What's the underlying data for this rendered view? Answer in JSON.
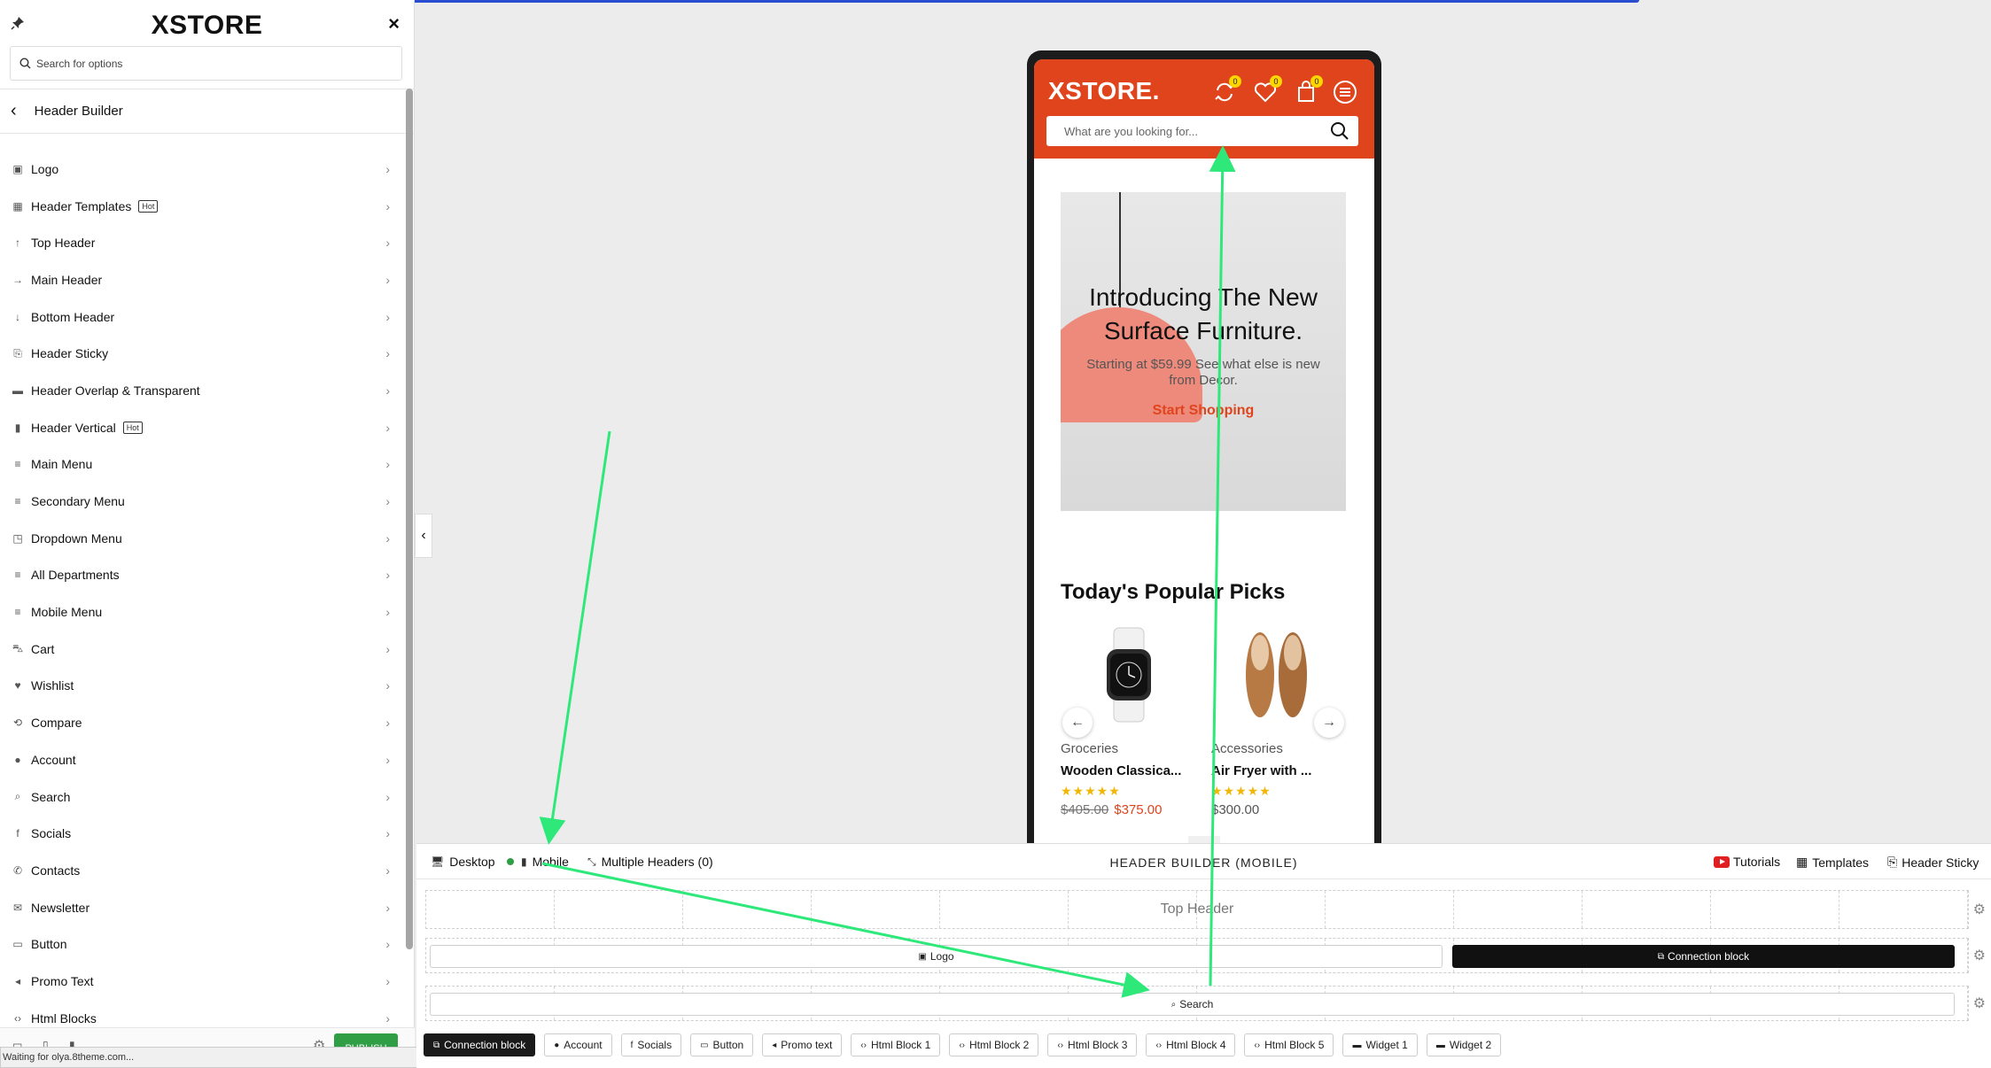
{
  "sidebar": {
    "brand": "XSTORE",
    "close": "×",
    "search_placeholder": "Search for options",
    "back_title": "Header Builder",
    "items": [
      {
        "label": "Logo",
        "hot": "",
        "icon": "image-icon"
      },
      {
        "label": "Header Templates",
        "hot": "Hot",
        "icon": "grid-icon"
      },
      {
        "label": "Top Header",
        "hot": "",
        "icon": "arrow-up-icon"
      },
      {
        "label": "Main Header",
        "hot": "",
        "icon": "arrow-right-icon"
      },
      {
        "label": "Bottom Header",
        "hot": "",
        "icon": "arrow-down-icon"
      },
      {
        "label": "Header Sticky",
        "hot": "",
        "icon": "paperclip-icon"
      },
      {
        "label": "Header Overlap & Transparent",
        "hot": "",
        "icon": "overlap-icon"
      },
      {
        "label": "Header Vertical",
        "hot": "Hot",
        "icon": "vertical-icon"
      },
      {
        "label": "Main Menu",
        "hot": "",
        "icon": "menu-icon"
      },
      {
        "label": "Secondary Menu",
        "hot": "",
        "icon": "menu-icon"
      },
      {
        "label": "Dropdown Menu",
        "hot": "",
        "icon": "dropdown-icon"
      },
      {
        "label": "All Departments",
        "hot": "",
        "icon": "menu-icon"
      },
      {
        "label": "Mobile Menu",
        "hot": "",
        "icon": "menu-icon"
      },
      {
        "label": "Cart",
        "hot": "",
        "icon": "cart-icon"
      },
      {
        "label": "Wishlist",
        "hot": "",
        "icon": "heart-icon"
      },
      {
        "label": "Compare",
        "hot": "",
        "icon": "compare-icon"
      },
      {
        "label": "Account",
        "hot": "",
        "icon": "user-icon"
      },
      {
        "label": "Search",
        "hot": "",
        "icon": "search-icon"
      },
      {
        "label": "Socials",
        "hot": "",
        "icon": "facebook-icon"
      },
      {
        "label": "Contacts",
        "hot": "",
        "icon": "phone-icon"
      },
      {
        "label": "Newsletter",
        "hot": "",
        "icon": "mail-icon"
      },
      {
        "label": "Button",
        "hot": "",
        "icon": "button-icon"
      },
      {
        "label": "Promo Text",
        "hot": "",
        "icon": "megaphone-icon"
      },
      {
        "label": "Html Blocks",
        "hot": "",
        "icon": "code-icon"
      }
    ],
    "publish": "PUBLISH",
    "status": "Waiting for olya.8theme.com..."
  },
  "preview": {
    "logo": "XSTORE.",
    "badges": {
      "compare": "0",
      "wishlist": "0",
      "cart": "0"
    },
    "search_placeholder": "What are you looking for...",
    "hero": {
      "title": "Introducing The New Surface Furniture.",
      "subtitle": "Starting at $59.99 See what else is new from Decor.",
      "cta": "Start Shopping"
    },
    "picks_title": "Today's Popular Picks",
    "products": [
      {
        "category": "Groceries",
        "name": "Wooden Classica...",
        "stars": "★★★★★",
        "old_price": "$405.00",
        "price": "$375.00"
      },
      {
        "category": "Accessories",
        "name": "Air Fryer with ...",
        "stars": "★★★★★",
        "price": "$300.00"
      }
    ]
  },
  "builder": {
    "tabs": {
      "desktop": "Desktop",
      "mobile": "Mobile",
      "multiple": "Multiple Headers (0)"
    },
    "title": "HEADER BUILDER (MOBILE)",
    "right": {
      "tutorials": "Tutorials",
      "templates": "Templates",
      "sticky": "Header Sticky"
    },
    "top_header_label": "Top Header",
    "main_row": {
      "logo": "Logo",
      "connection": "Connection block"
    },
    "bottom_row": {
      "search": "Search"
    },
    "elements": [
      "Connection block",
      "Account",
      "Socials",
      "Button",
      "Promo text",
      "Html Block 1",
      "Html Block 2",
      "Html Block 3",
      "Html Block 4",
      "Html Block 5",
      "Widget 1",
      "Widget 2"
    ]
  },
  "colors": {
    "brand": "#e0441c",
    "publish": "#2f9e44",
    "annotation_arrow": "#2ee87a",
    "badge": "#ffd600"
  }
}
